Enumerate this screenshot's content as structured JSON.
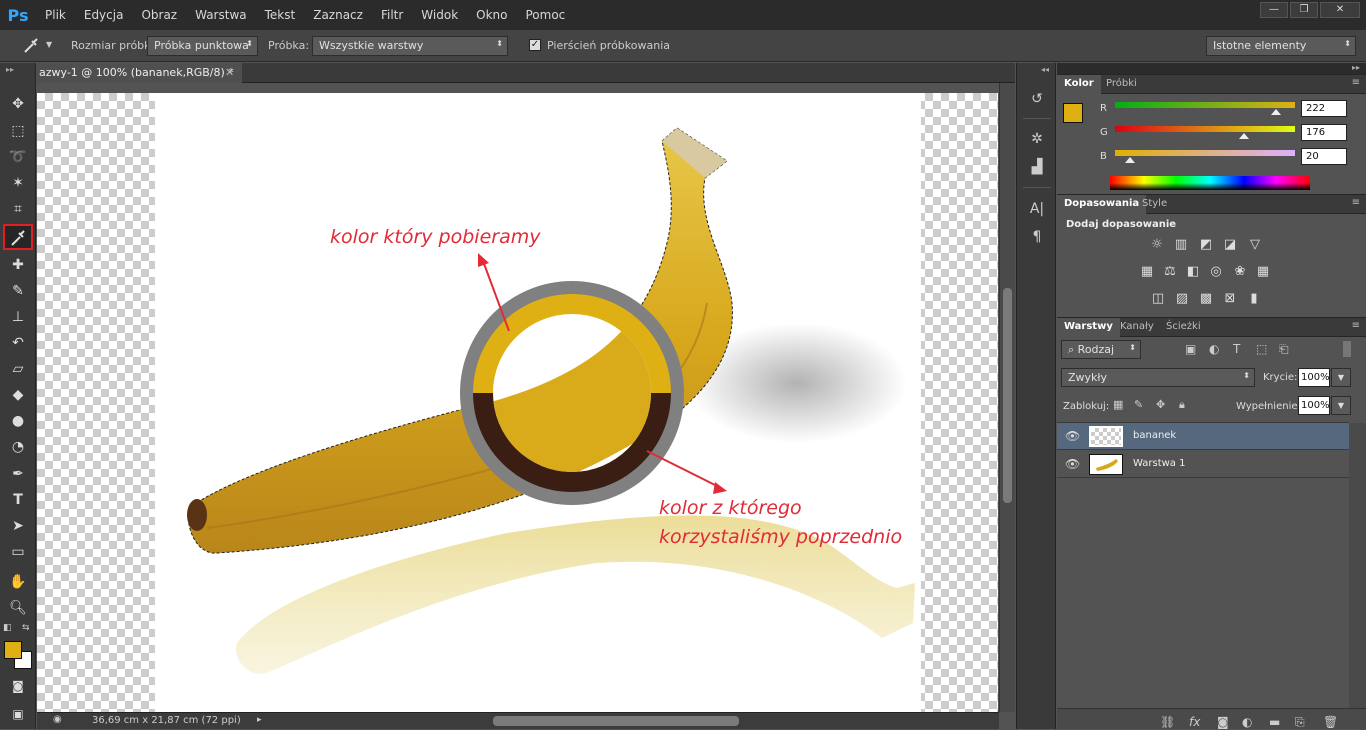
{
  "app": {
    "logo": "Ps"
  },
  "menu": [
    "Plik",
    "Edycja",
    "Obraz",
    "Warstwa",
    "Tekst",
    "Zaznacz",
    "Filtr",
    "Widok",
    "Okno",
    "Pomoc"
  ],
  "window_controls": {
    "minimize": "—",
    "restore": "❐",
    "close": "✕"
  },
  "options": {
    "sample_size_label": "Rozmiar próbki:",
    "sample_size_value": "Próbka punktowa",
    "sample_label": "Próbka:",
    "sample_value": "Wszystkie warstwy",
    "ring_checked": true,
    "ring_label": "Pierścień próbkowania",
    "workspace": "Istotne elementy"
  },
  "document": {
    "tab_title": "azwy-1 @ 100% (bananek,RGB/8) *",
    "status": "36,69 cm x 21,87 cm (72 ppi)"
  },
  "canvas": {
    "annotation_top": "kolor który pobieramy",
    "annotation_bottom_1": "kolor z którego",
    "annotation_bottom_2": "korzystaliśmy poprzednio",
    "new_color": "#deb014",
    "previous_color": "#3a1e14",
    "ring_color": "#808080"
  },
  "tools": [
    "move",
    "marquee",
    "lasso",
    "magic-wand",
    "crop",
    "eyedropper",
    "healing",
    "brush",
    "clone-stamp",
    "history-brush",
    "eraser",
    "paint-bucket",
    "blur",
    "dodge",
    "pen",
    "type",
    "path-select",
    "shape",
    "hand",
    "zoom"
  ],
  "color_panel": {
    "tabs": [
      "Kolor",
      "Próbki"
    ],
    "r_label": "R",
    "g_label": "G",
    "b_label": "B",
    "r": "222",
    "g": "176",
    "b": "20",
    "fg": "#deb014"
  },
  "adjustments_panel": {
    "tabs": [
      "Dopasowania",
      "Style"
    ],
    "heading": "Dodaj dopasowanie"
  },
  "layers_panel": {
    "tabs": [
      "Warstwy",
      "Kanały",
      "Ścieżki"
    ],
    "filter": "Rodzaj",
    "blend_mode": "Zwykły",
    "opacity_label": "Krycie:",
    "opacity": "100%",
    "lock_label": "Zablokuj:",
    "fill_label": "Wypełnienie:",
    "fill": "100%",
    "layers": [
      {
        "name": "bananek",
        "selected": true
      },
      {
        "name": "Warstwa 1",
        "selected": false
      }
    ]
  }
}
